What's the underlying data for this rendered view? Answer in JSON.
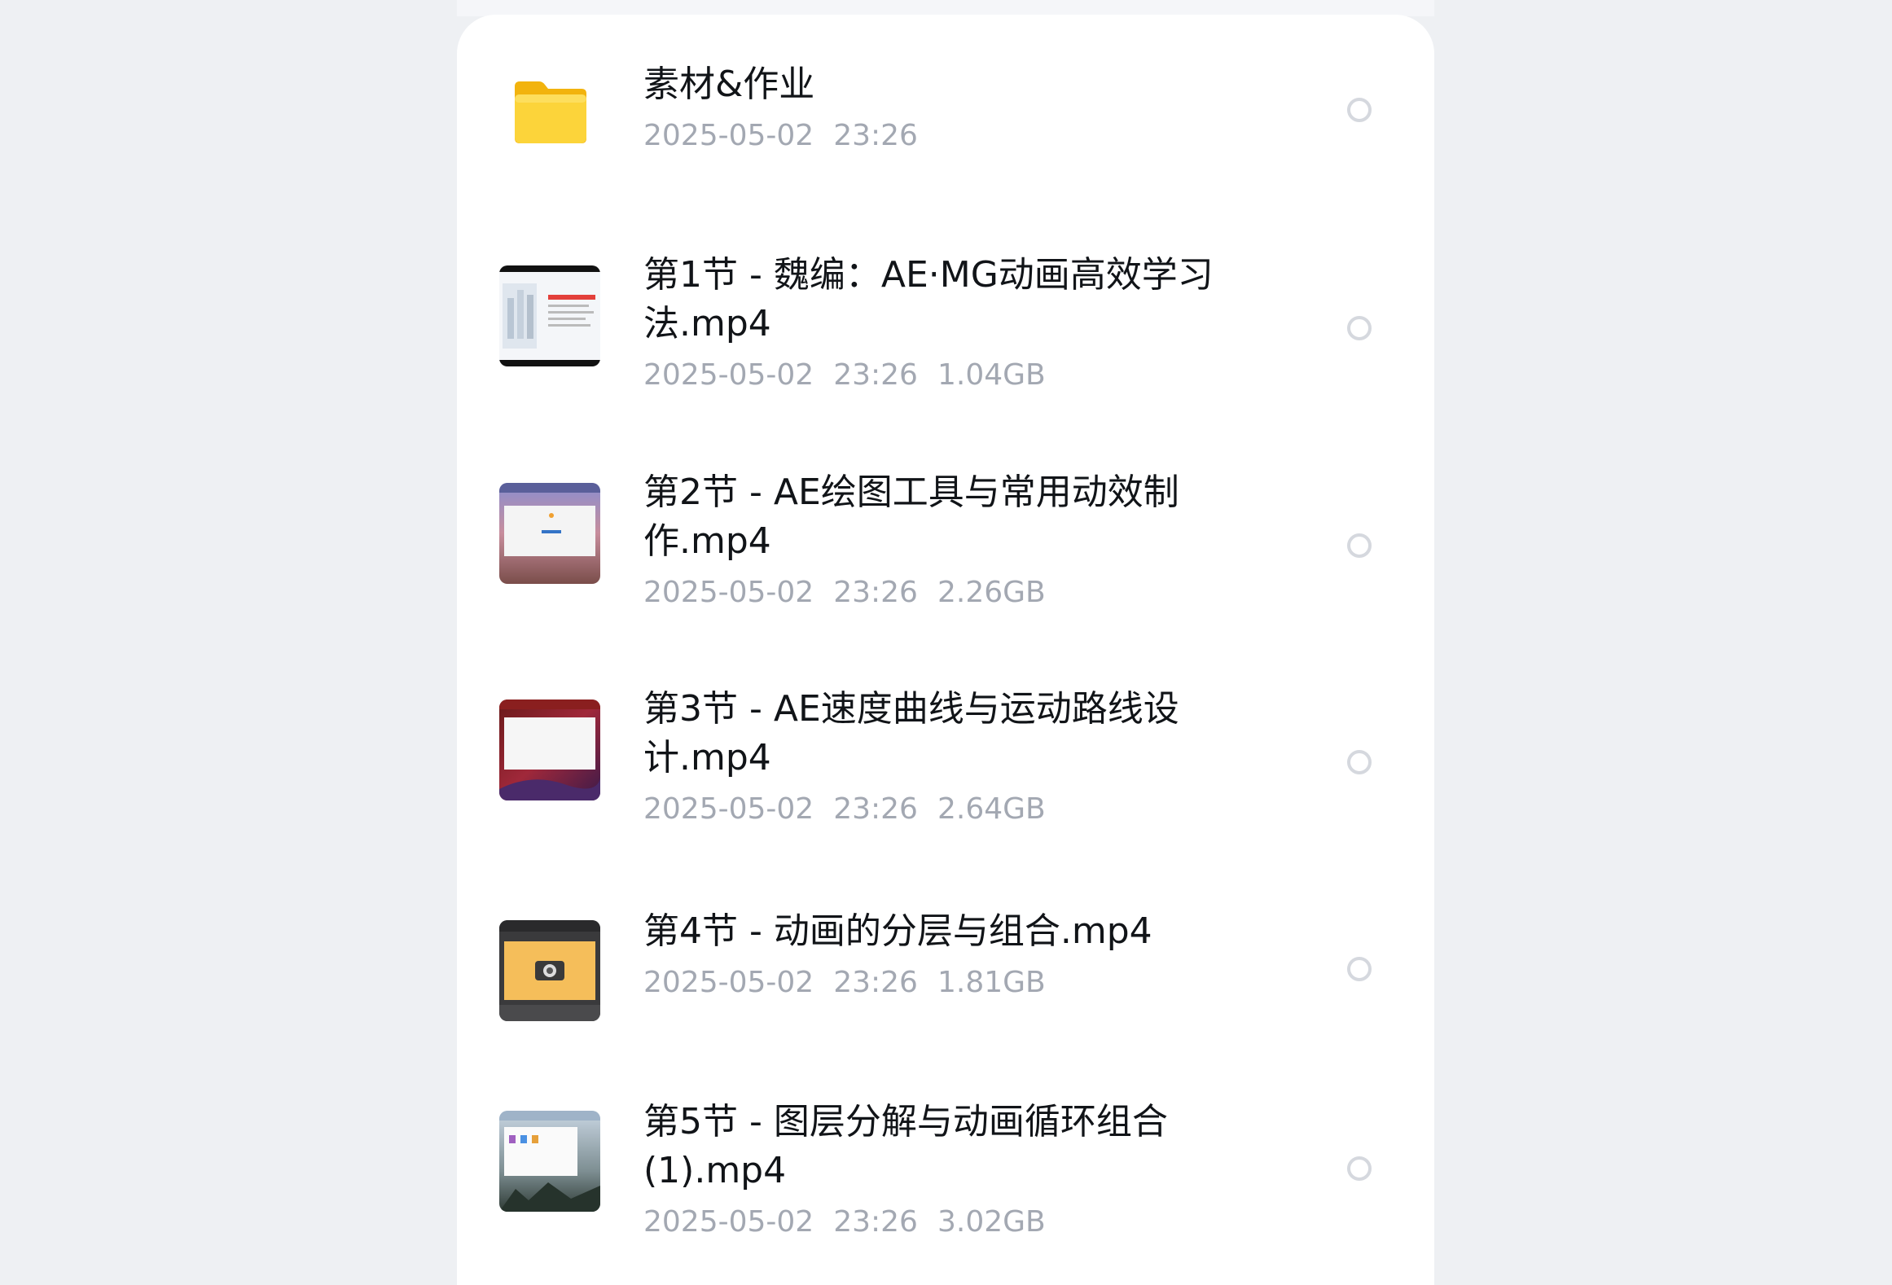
{
  "files": [
    {
      "name": "素材&作业",
      "date": "2025-05-02",
      "time": "23:26",
      "size": "",
      "type": "folder",
      "icon": "folder-icon"
    },
    {
      "name": "第1节 - 魏编：AE·MG动画高效学习法.mp4",
      "date": "2025-05-02",
      "time": "23:26",
      "size": "1.04GB",
      "type": "video",
      "icon": "video-thumbnail"
    },
    {
      "name": "第2节 - AE绘图工具与常用动效制作.mp4",
      "date": "2025-05-02",
      "time": "23:26",
      "size": "2.26GB",
      "type": "video",
      "icon": "video-thumbnail"
    },
    {
      "name": "第3节 - AE速度曲线与运动路线设计.mp4",
      "date": "2025-05-02",
      "time": "23:26",
      "size": "2.64GB",
      "type": "video",
      "icon": "video-thumbnail"
    },
    {
      "name": "第4节 - 动画的分层与组合.mp4",
      "date": "2025-05-02",
      "time": "23:26",
      "size": "1.81GB",
      "type": "video",
      "icon": "video-thumbnail"
    },
    {
      "name": "第5节 - 图层分解与动画循环组合(1).mp4",
      "date": "2025-05-02",
      "time": "23:26",
      "size": "3.02GB",
      "type": "video",
      "icon": "video-thumbnail"
    }
  ],
  "colors": {
    "background": "#eef0f3",
    "panel": "#ffffff",
    "title_text": "#111418",
    "meta_text": "#a3a8b2",
    "folder_yellow": "#f9c41c",
    "radio_border": "#d5d8de"
  }
}
